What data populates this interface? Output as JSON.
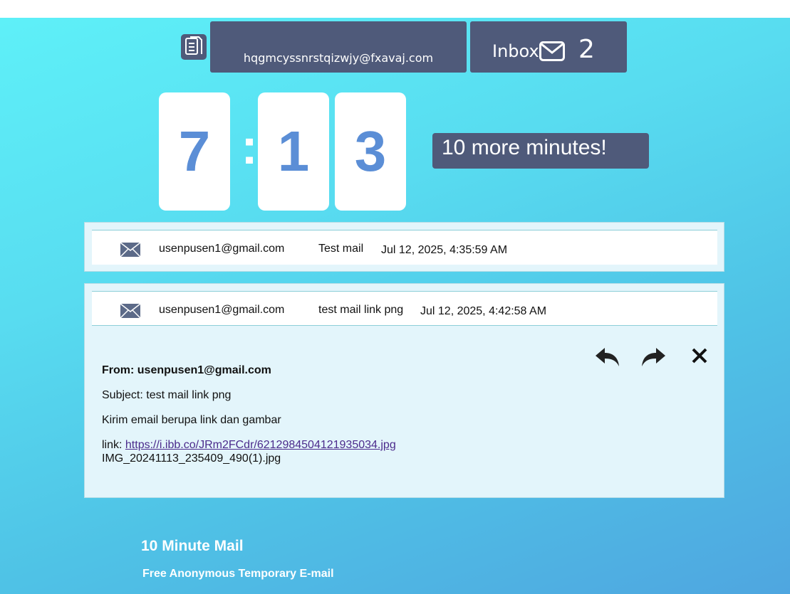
{
  "header": {
    "email_address": "hqgmcyssnrstqizwjy@fxavaj.com",
    "inbox_label": "Inbox",
    "inbox_count": "2",
    "copy_icon": "copy-document-icon",
    "inbox_icon": "envelope-icon"
  },
  "timer": {
    "minutes": "7",
    "separator": ":",
    "seconds_tens": "1",
    "seconds_ones": "3",
    "more_button": "10 more minutes!"
  },
  "mails": [
    {
      "from": "usenpusen1@gmail.com",
      "subject": "Test mail",
      "date": "Jul 12, 2025, 4:35:59 AM"
    },
    {
      "from": "usenpusen1@gmail.com",
      "subject": "test mail link png",
      "date": "Jul 12, 2025, 4:42:58 AM"
    }
  ],
  "open_mail": {
    "from_line": "From: usenpusen1@gmail.com",
    "subject_line": "Subject: test mail link png",
    "body": "Kirim email berupa link dan gambar",
    "link_prefix": "link: ",
    "link_text": "https://i.ibb.co/JRm2FCdr/6212984504121935034.jpg",
    "attachment_name": "IMG_20241113_235409_490(1).jpg",
    "actions": [
      "reply-icon",
      "forward-icon",
      "close-icon"
    ]
  },
  "footer": {
    "title": "10 Minute Mail",
    "subtitle": "Free Anonymous Temporary E-mail"
  },
  "colors": {
    "panel": "#4f5a7a",
    "digit": "#5b8ed6",
    "card_bg": "#e3f5fb",
    "link": "#4b2b8c"
  }
}
